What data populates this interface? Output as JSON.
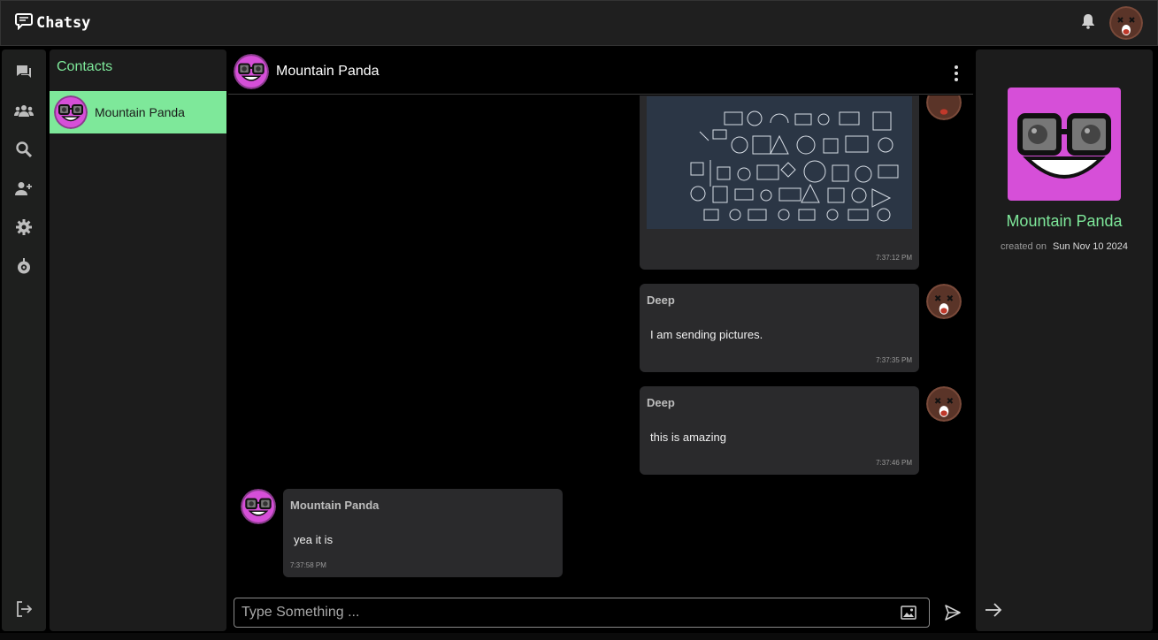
{
  "app": {
    "name": "Chatsy"
  },
  "sidebar": {
    "icons": [
      "chats-icon",
      "groups-icon",
      "search-icon",
      "add-user-icon",
      "settings-icon",
      "bot-icon",
      "logout-icon"
    ]
  },
  "contacts": {
    "title": "Contacts",
    "items": [
      {
        "name": "Mountain Panda",
        "active": true
      }
    ]
  },
  "chat": {
    "header_name": "Mountain Panda",
    "messages": [
      {
        "sender": "",
        "type": "image",
        "time": "7:37:12 PM",
        "own": true
      },
      {
        "sender": "Deep",
        "text": "I am sending pictures.",
        "time": "7:37:35 PM",
        "own": true
      },
      {
        "sender": "Deep",
        "text": "this is amazing",
        "time": "7:37:46 PM",
        "own": true
      },
      {
        "sender": "Mountain Panda",
        "text": "yea it is",
        "time": "7:37:58 PM",
        "own": false
      }
    ],
    "input_placeholder": "Type Something ..."
  },
  "info": {
    "name": "Mountain Panda",
    "created_label": "created on",
    "created_date": "Sun Nov 10 2024"
  },
  "colors": {
    "accent": "#7ee89a",
    "panda_bg": "#d64fd8",
    "bubble": "#2a2a2c"
  }
}
